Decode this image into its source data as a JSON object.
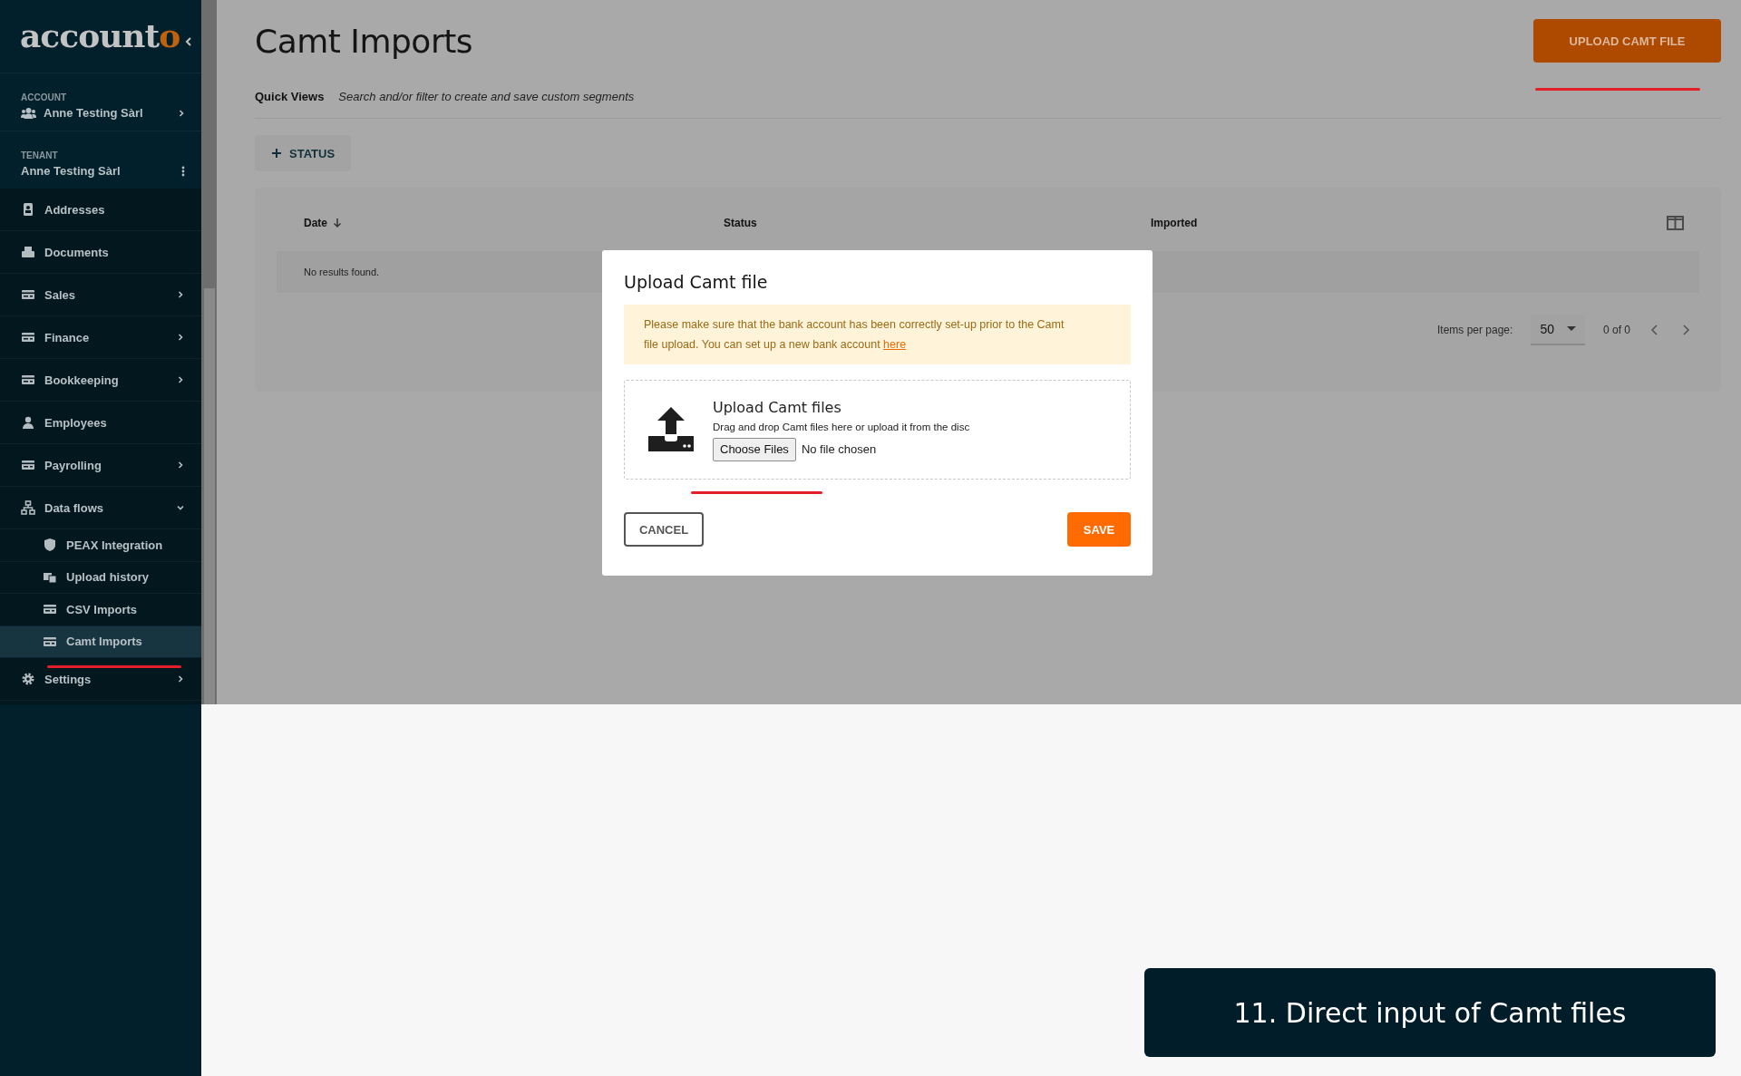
{
  "sidebar": {
    "logo": {
      "text": "account",
      "accent": "o"
    },
    "account": {
      "label": "ACCOUNT",
      "name": "Anne Testing Sàrl"
    },
    "tenant": {
      "label": "TENANT",
      "name": "Anne Testing Sàrl"
    },
    "items": [
      {
        "label": "Addresses",
        "selected": false
      },
      {
        "label": "Documents",
        "selected": false
      },
      {
        "label": "Sales",
        "selected": false,
        "expanded": false
      },
      {
        "label": "Finance",
        "selected": false,
        "expanded": false
      },
      {
        "label": "Bookkeeping",
        "selected": false,
        "expanded": false
      },
      {
        "label": "Employees",
        "selected": false
      },
      {
        "label": "Payrolling",
        "selected": false,
        "expanded": false
      },
      {
        "label": "Data flows",
        "selected": false,
        "expanded": true,
        "children": [
          {
            "label": "PEAX Integration",
            "selected": false
          },
          {
            "label": "Upload history",
            "selected": false
          },
          {
            "label": "CSV Imports",
            "selected": false
          },
          {
            "label": "Camt Imports",
            "selected": true
          }
        ]
      },
      {
        "label": "Settings",
        "selected": false,
        "expanded": false
      }
    ]
  },
  "main": {
    "title": "Camt Imports",
    "upload_button": "UPLOAD CAMT FILE",
    "quick_views": {
      "label": "Quick Views",
      "hint": "Search and/or filter to create and save custom segments"
    },
    "filter_chip": "STATUS",
    "table": {
      "columns": [
        {
          "label": "Date",
          "sorted": true
        },
        {
          "label": "Status",
          "sorted": false
        },
        {
          "label": "Imported",
          "sorted": false
        }
      ],
      "empty": "No results found.",
      "pagination": {
        "label": "Items per page:",
        "per_page": "50",
        "range": "0 of 0"
      }
    }
  },
  "modal": {
    "title": "Upload Camt file",
    "alert": {
      "text": "Please make sure that the bank account has been correctly set-up prior to the Camt file upload. You can set up a new bank account",
      "link": "here"
    },
    "dropzone": {
      "title": "Upload Camt files",
      "hint": "Drag and drop Camt files here or upload it from the disc",
      "file_button": "Choose Files",
      "file_status": "No file chosen"
    },
    "cancel": "CANCEL",
    "save": "SAVE"
  },
  "caption": "11. Direct input of Camt files"
}
